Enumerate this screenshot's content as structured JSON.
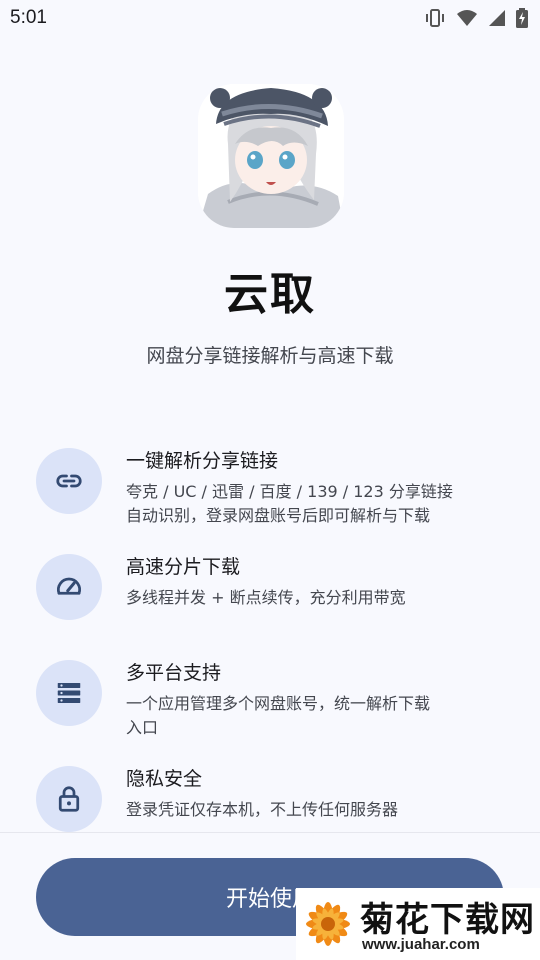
{
  "status_bar": {
    "time": "5:01",
    "icons": [
      "vibrate-icon",
      "wifi-icon",
      "signal-icon",
      "battery-charging-icon"
    ]
  },
  "app": {
    "logo": "anime-avatar-logo",
    "title": "云取",
    "subtitle": "网盘分享链接解析与高速下载"
  },
  "features": [
    {
      "icon": "link-icon",
      "title": "一键解析分享链接",
      "desc_lines": [
        "夸克 / UC / 迅雷 / 百度 / 139 / 123 分享链接",
        "自动识别，登录网盘账号后即可解析与下载"
      ]
    },
    {
      "icon": "speedometer-icon",
      "title": "高速分片下载",
      "desc_lines": [
        "多线程并发 + 断点续传，充分利用带宽"
      ]
    },
    {
      "icon": "storage-icon",
      "title": "多平台支持",
      "desc_lines": [
        "一个应用管理多个网盘账号，统一解析下载",
        "入口"
      ]
    },
    {
      "icon": "lock-icon",
      "title": "隐私安全",
      "desc_lines": [
        "登录凭证仅存本机，不上传任何服务器"
      ]
    }
  ],
  "start_button": {
    "label": "开始使用"
  },
  "watermark": {
    "name": "菊花下载网",
    "url": "www.juahar.com"
  },
  "colors": {
    "background": "#f8f9fe",
    "accent": "#4a6394",
    "icon_circle": "#dbe3f8",
    "icon_color": "#334a72"
  }
}
